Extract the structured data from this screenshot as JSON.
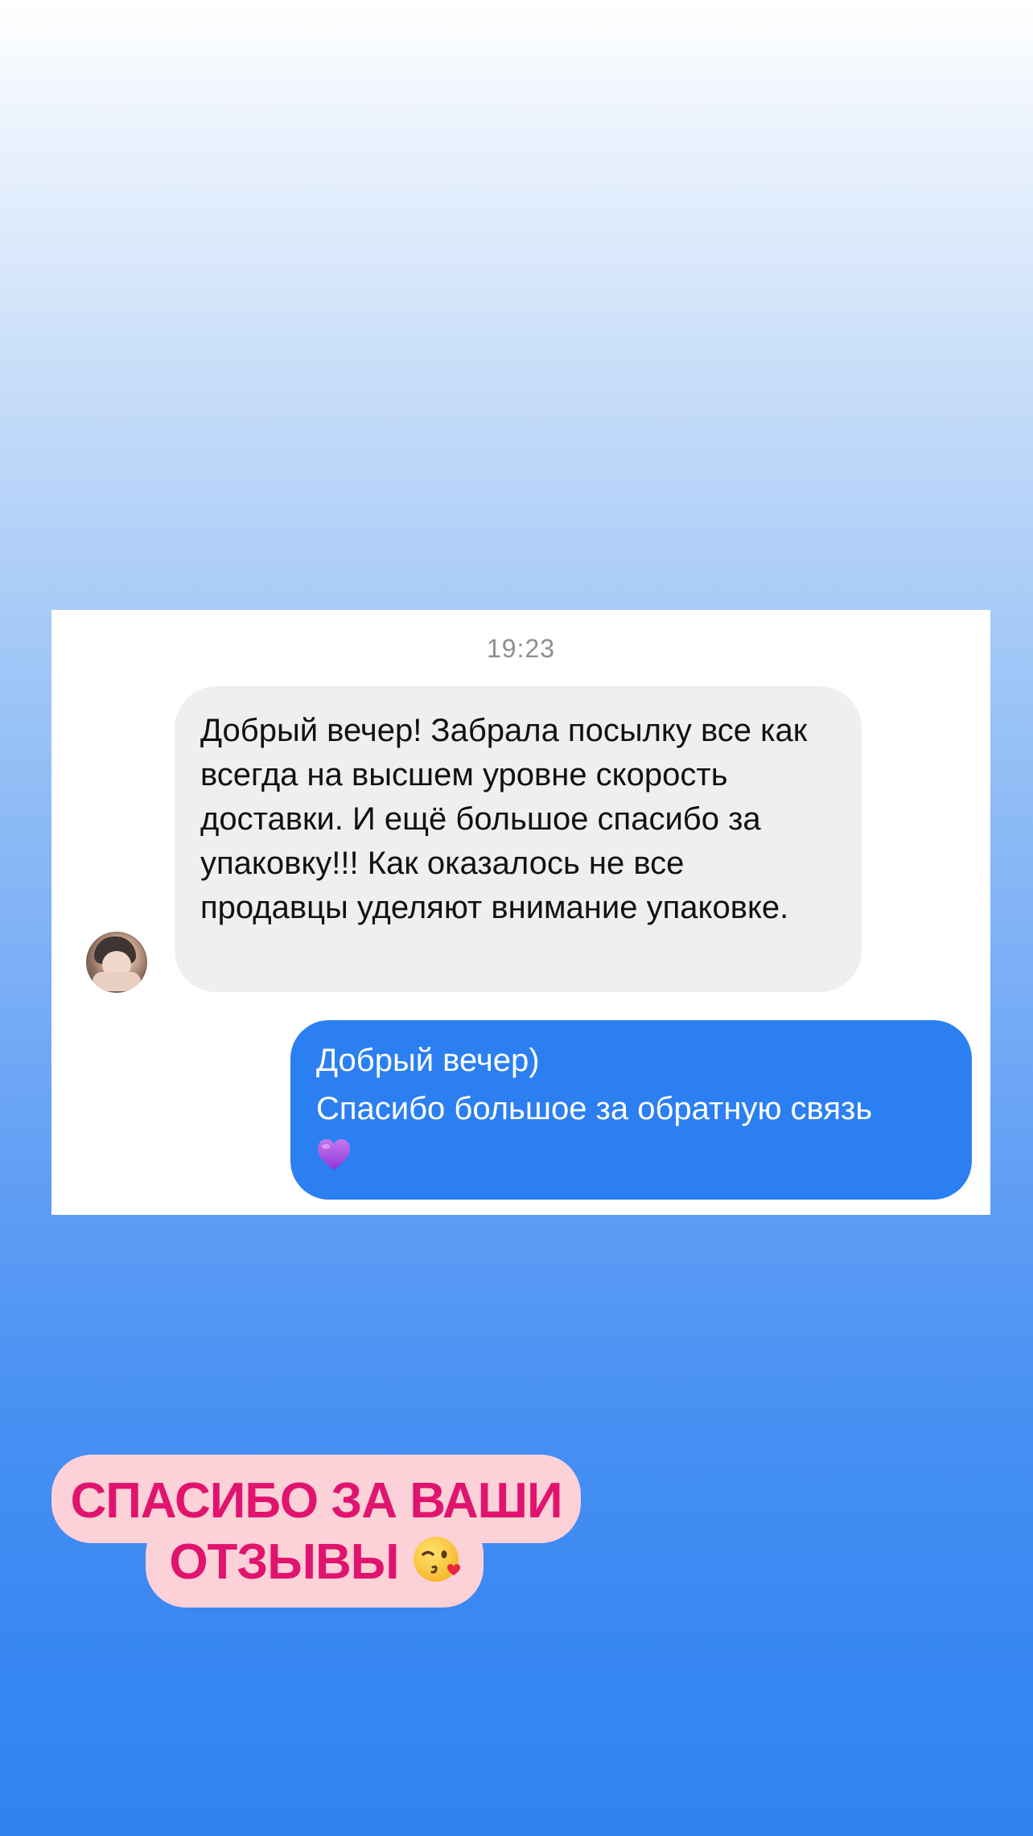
{
  "chat": {
    "timestamp": "19:23",
    "incoming_message": "Добрый вечер! Забрала посылку все как всегда на высшем уровне скорость доставки. И ещё большое спасибо за упаковку!!! Как оказалось не все продавцы уделяют внимание упаковке.",
    "outgoing_message": {
      "line1": "Добрый вечер)",
      "line2": "Спасибо большое за обратную связь"
    },
    "outgoing_emoji_icon": "purple-heart-icon",
    "incoming_bubble_color": "#efefef",
    "outgoing_bubble_color": "#2b7ff0"
  },
  "sticker": {
    "line1": "СПАСИБО ЗА ВАШИ",
    "line2": "ОТЗЫВЫ",
    "emoji_icon": "kissing-wink-face-icon",
    "text_color": "#e0146e",
    "background_color": "#fdd1d8"
  }
}
